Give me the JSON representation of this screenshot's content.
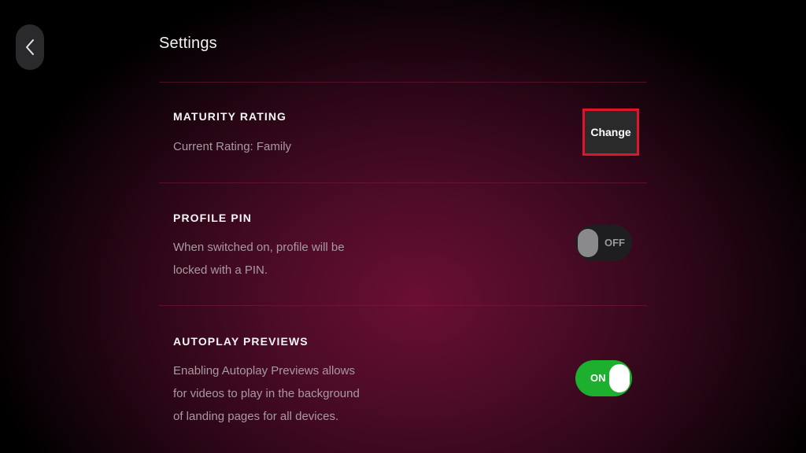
{
  "header": {
    "back_icon": "chevron-left-icon",
    "title": "Settings"
  },
  "maturity_rating": {
    "title": "MATURITY RATING",
    "description": "Current Rating: Family",
    "button_label": "Change"
  },
  "profile_pin": {
    "title": "PROFILE PIN",
    "description": "When switched on, profile will be locked with a PIN.",
    "toggle_state": "OFF"
  },
  "autoplay_previews": {
    "title": "AUTOPLAY PREVIEWS",
    "description": "Enabling Autoplay Previews allows for videos to play in the background of landing pages for all devices.",
    "toggle_state": "ON"
  },
  "colors": {
    "toggle_on": "#1db02e",
    "toggle_off": "#1e1e20",
    "highlight_border": "#e0142a"
  }
}
